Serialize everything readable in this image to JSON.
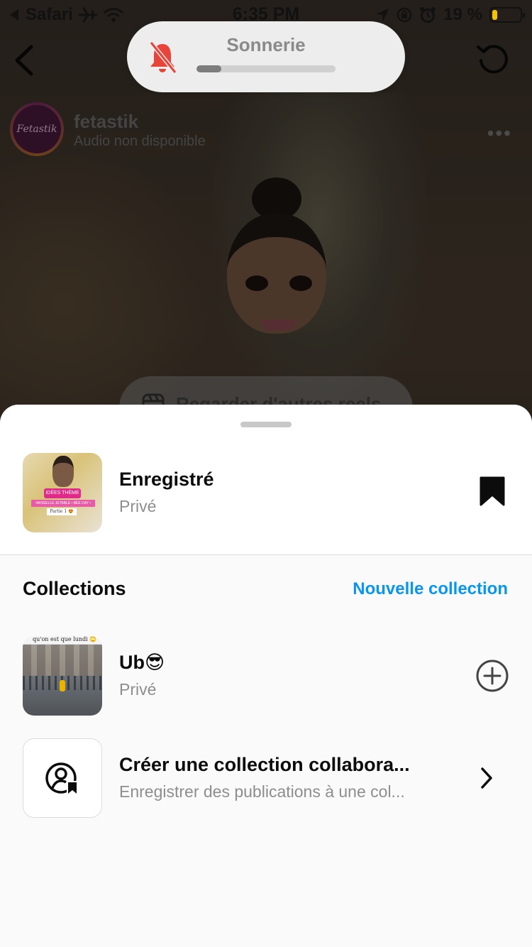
{
  "status_bar": {
    "back_app": "Safari",
    "time": "6:35 PM",
    "battery_percent": "19 %",
    "battery_level": 0.19,
    "icons": [
      "airplane-icon",
      "wifi-icon",
      "location-arrow-icon",
      "orientation-lock-icon",
      "alarm-icon",
      "battery-icon"
    ]
  },
  "ringer_hud": {
    "label": "Sonnerie",
    "icon": "bell-slash-icon",
    "volume_level": 0.18,
    "icon_color": "#e8443a"
  },
  "post": {
    "username": "fetastik",
    "audio_status": "Audio non disponible",
    "avatar_text": "Fetastik",
    "more_label": "•••",
    "reels_button_label": "Regarder d'autres reels"
  },
  "sheet": {
    "saved": {
      "title": "Enregistré",
      "subtitle": "Privé",
      "thumb_lines": [
        "IDÉES THÈME",
        "VAISSELLE JETABLE • BEE DAY •",
        "Partie 1 😍"
      ],
      "icon": "bookmark-filled-icon"
    },
    "collections_heading": "Collections",
    "new_collection_label": "Nouvelle collection",
    "collections": [
      {
        "title": "Ub😎",
        "subtitle": "Privé",
        "thumb_caption": "qu'on est que lundi 🙄",
        "action_icon": "plus-circle-icon"
      },
      {
        "title": "Créer une collection collabora...",
        "subtitle": "Enregistrer des publications à une col...",
        "thumb_icon": "collab-user-bookmark-icon",
        "action_icon": "chevron-right-icon"
      }
    ]
  },
  "colors": {
    "accent_blue": "#0a95f0",
    "text_primary": "#0c0c0c",
    "text_secondary": "#8e8e8e"
  }
}
